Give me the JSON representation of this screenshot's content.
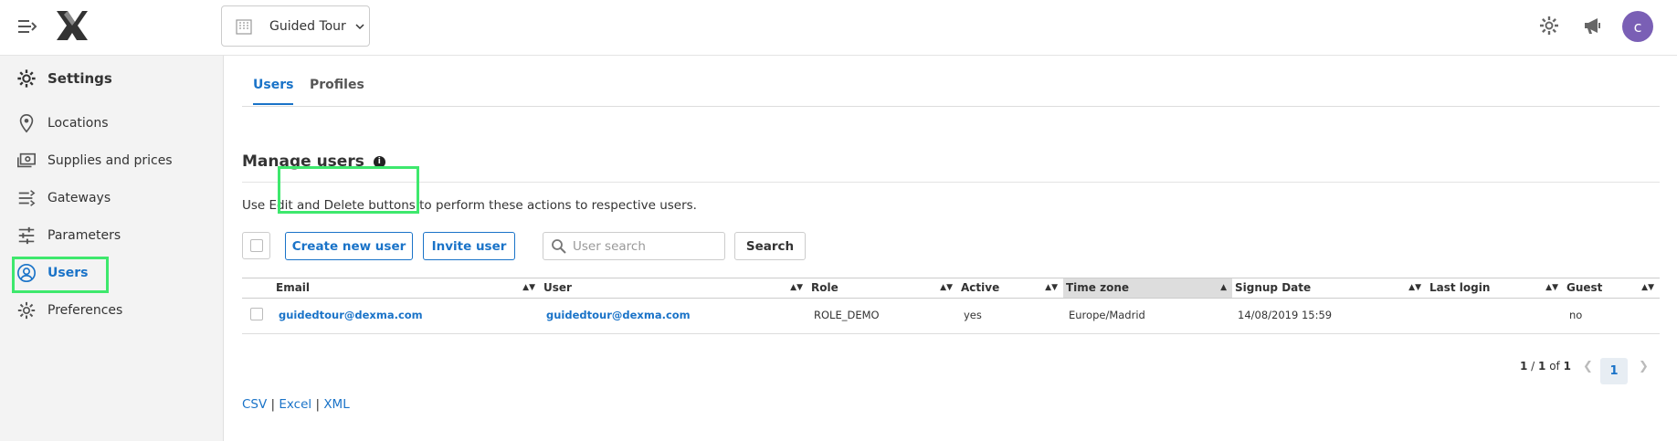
{
  "header": {
    "site_name": "Guided Tour",
    "avatar_letter": "c"
  },
  "sidebar": {
    "title": "Settings",
    "items": [
      {
        "label": "Locations",
        "icon": "location-pin-icon"
      },
      {
        "label": "Supplies and prices",
        "icon": "money-icon"
      },
      {
        "label": "Gateways",
        "icon": "gateway-icon"
      },
      {
        "label": "Parameters",
        "icon": "sliders-icon"
      },
      {
        "label": "Users",
        "icon": "user-circle-icon",
        "active": true
      },
      {
        "label": "Preferences",
        "icon": "gear-icon"
      }
    ]
  },
  "tabs": [
    {
      "label": "Users",
      "active": true
    },
    {
      "label": "Profiles",
      "active": false
    }
  ],
  "manage": {
    "title": "Manage users",
    "info_glyph": "i",
    "description": "Use Edit and Delete buttons to perform these actions to respective users.",
    "create_label": "Create new user",
    "invite_label": "Invite user",
    "search_placeholder": "User search",
    "search_label": "Search"
  },
  "table": {
    "columns": [
      "Email",
      "User",
      "Role",
      "Active",
      "Time zone",
      "Signup Date",
      "Last login",
      "Guest"
    ],
    "sorted_column": "Time zone",
    "rows": [
      {
        "email": "guidedtour@dexma.com",
        "user": "guidedtour@dexma.com",
        "role": "ROLE_DEMO",
        "active": "yes",
        "timezone": "Europe/Madrid",
        "signup": "14/08/2019 15:59",
        "last_login": "",
        "guest": "no"
      }
    ]
  },
  "pagination": {
    "current": "1",
    "total": "1",
    "pages": "1",
    "of_label": "of",
    "page_button": "1"
  },
  "exports": {
    "csv": "CSV",
    "excel": "Excel",
    "xml": "XML",
    "separator": "|"
  },
  "colors": {
    "accent": "#1a73c8",
    "highlight": "#3ee86d",
    "avatar": "#7a5fb5"
  }
}
